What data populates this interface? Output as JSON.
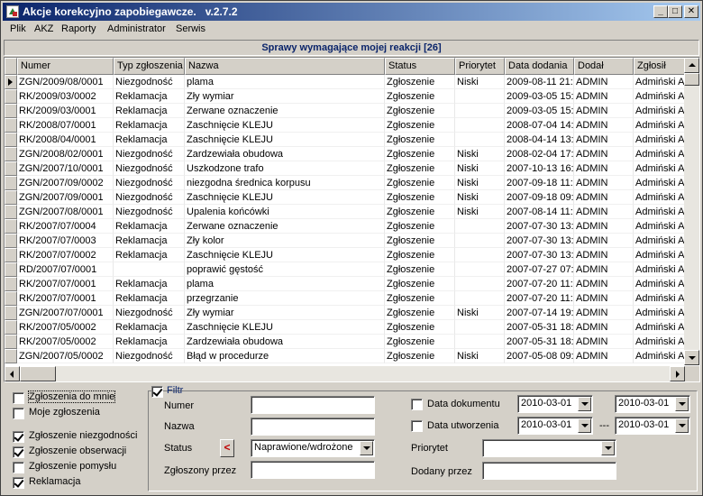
{
  "window": {
    "title": "Akcje korekcyjno zapobiegawcze.   v.2.7.2",
    "controls": [
      "_",
      "□",
      "✕"
    ]
  },
  "menu": [
    {
      "label": "Plik"
    },
    {
      "label": "AKZ"
    },
    {
      "label": "Raporty"
    },
    {
      "label": "Administrator"
    },
    {
      "label": "Serwis"
    }
  ],
  "panel_header": "Sprawy wymagające mojej reakcji [26]",
  "table": {
    "columns": [
      "Numer",
      "Typ zgłoszenia",
      "Nazwa",
      "Status",
      "Priorytet",
      "Data dodania",
      "Dodał",
      "Zgłosił"
    ],
    "rows": [
      [
        "ZGN/2009/08/0001",
        "Niezgodność",
        "plama",
        "Zgłoszenie",
        "Niski",
        "2009-08-11 21:",
        "ADMIN",
        "Admiński A"
      ],
      [
        "RK/2009/03/0002",
        "Reklamacja",
        "Zły wymiar",
        "Zgłoszenie",
        "",
        "2009-03-05 15:",
        "ADMIN",
        "Admiński A"
      ],
      [
        "RK/2009/03/0001",
        "Reklamacja",
        "Zerwane oznaczenie",
        "Zgłoszenie",
        "",
        "2009-03-05 15:",
        "ADMIN",
        "Admiński A"
      ],
      [
        "RK/2008/07/0001",
        "Reklamacja",
        "Zaschnięcie KLEJU",
        "Zgłoszenie",
        "",
        "2008-07-04 14:",
        "ADMIN",
        "Admiński A"
      ],
      [
        "RK/2008/04/0001",
        "Reklamacja",
        "Zaschnięcie KLEJU",
        "Zgłoszenie",
        "",
        "2008-04-14 13:",
        "ADMIN",
        "Admiński A"
      ],
      [
        "ZGN/2008/02/0001",
        "Niezgodność",
        "Zardzewiała obudowa",
        "Zgłoszenie",
        "Niski",
        "2008-02-04 17:",
        "ADMIN",
        "Admiński A"
      ],
      [
        "ZGN/2007/10/0001",
        "Niezgodność",
        "Uszkodzone trafo",
        "Zgłoszenie",
        "Niski",
        "2007-10-13 16:",
        "ADMIN",
        "Admiński A"
      ],
      [
        "ZGN/2007/09/0002",
        "Niezgodność",
        "niezgodna średnica korpusu",
        "Zgłoszenie",
        "Niski",
        "2007-09-18 11:",
        "ADMIN",
        "Admiński A"
      ],
      [
        "ZGN/2007/09/0001",
        "Niezgodność",
        "Zaschnięcie KLEJU",
        "Zgłoszenie",
        "Niski",
        "2007-09-18 09:",
        "ADMIN",
        "Admiński A"
      ],
      [
        "ZGN/2007/08/0001",
        "Niezgodność",
        "Upalenia końcówki",
        "Zgłoszenie",
        "Niski",
        "2007-08-14 11:",
        "ADMIN",
        "Admiński A"
      ],
      [
        "RK/2007/07/0004",
        "Reklamacja",
        "Zerwane oznaczenie",
        "Zgłoszenie",
        "",
        "2007-07-30 13:",
        "ADMIN",
        "Admiński A"
      ],
      [
        "RK/2007/07/0003",
        "Reklamacja",
        "Zły kolor",
        "Zgłoszenie",
        "",
        "2007-07-30 13:",
        "ADMIN",
        "Admiński A"
      ],
      [
        "RK/2007/07/0002",
        "Reklamacja",
        "Zaschnięcie KLEJU",
        "Zgłoszenie",
        "",
        "2007-07-30 13:",
        "ADMIN",
        "Admiński A"
      ],
      [
        "RD/2007/07/0001",
        "",
        "poprawić gęstość",
        "Zgłoszenie",
        "",
        "2007-07-27 07:",
        "ADMIN",
        "Admiński A"
      ],
      [
        "RK/2007/07/0001",
        "Reklamacja",
        "plama",
        "Zgłoszenie",
        "",
        "2007-07-20 11:",
        "ADMIN",
        "Admiński A"
      ],
      [
        "RK/2007/07/0001",
        "Reklamacja",
        "przegrzanie",
        "Zgłoszenie",
        "",
        "2007-07-20 11:",
        "ADMIN",
        "Admiński A"
      ],
      [
        "ZGN/2007/07/0001",
        "Niezgodność",
        "Zły wymiar",
        "Zgłoszenie",
        "Niski",
        "2007-07-14 19:",
        "ADMIN",
        "Admiński A"
      ],
      [
        "RK/2007/05/0002",
        "Reklamacja",
        "Zaschnięcie KLEJU",
        "Zgłoszenie",
        "",
        "2007-05-31 18:",
        "ADMIN",
        "Admiński A"
      ],
      [
        "RK/2007/05/0002",
        "Reklamacja",
        "Zardzewiała obudowa",
        "Zgłoszenie",
        "",
        "2007-05-31 18:",
        "ADMIN",
        "Admiński A"
      ],
      [
        "ZGN/2007/05/0002",
        "Niezgodność",
        "Błąd w procedurze",
        "Zgłoszenie",
        "Niski",
        "2007-05-08 09:",
        "ADMIN",
        "Admiński A"
      ]
    ]
  },
  "left_filters": [
    {
      "label": "Zgłoszenia do mnie",
      "checked": false
    },
    {
      "label": "Moje zgłoszenia",
      "checked": false
    },
    {
      "label": "Zgłoszenie niezgodności",
      "checked": true
    },
    {
      "label": "Zgłoszenie obserwacji",
      "checked": true
    },
    {
      "label": "Zgłoszenie pomysłu",
      "checked": false
    },
    {
      "label": "Reklamacja",
      "checked": true
    }
  ],
  "filter": {
    "label": "Filtr",
    "checked": true,
    "numer_label": "Numer",
    "numer_value": "",
    "nazwa_label": "Nazwa",
    "nazwa_value": "",
    "status_label": "Status",
    "status_op": "<",
    "status_value": "Naprawione/wdrożone",
    "zglaszajacy_label": "Zgłoszony przez",
    "zglaszajacy_value": "",
    "data_dokumentu_label": "Data dokumentu",
    "data_dokumentu_checked": false,
    "data_dokumentu_from": "2010-03-01",
    "data_dokumentu_to": "2010-03-01",
    "data_utworzenia_label": "Data utworzenia",
    "data_utworzenia_checked": false,
    "data_utworzenia_from": "2010-03-01",
    "data_utworzenia_separator": "---",
    "data_utworzenia_to": "2010-03-01",
    "priorytet_label": "Priorytet",
    "priorytet_value": "",
    "dodany_label": "Dodany przez",
    "dodany_value": ""
  }
}
